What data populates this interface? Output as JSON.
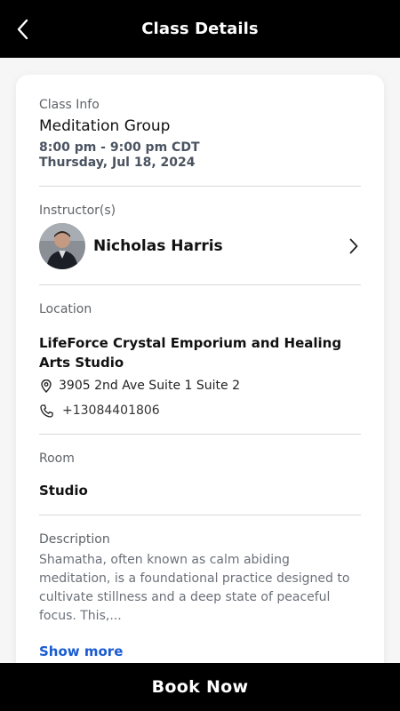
{
  "header": {
    "title": "Class Details",
    "back_icon": "chevron-left-icon"
  },
  "class_info": {
    "label": "Class Info",
    "name": "Meditation Group",
    "time": "8:00 pm - 9:00 pm CDT",
    "date": "Thursday, Jul 18, 2024"
  },
  "instructor": {
    "label": "Instructor(s)",
    "name": "Nicholas Harris",
    "chevron_icon": "chevron-right-icon"
  },
  "location": {
    "label": "Location",
    "name": "LifeForce Crystal Emporium and Healing Arts Studio",
    "address": "3905 2nd Ave Suite 1 Suite 2",
    "phone": "+13084401806",
    "address_icon": "map-pin-icon",
    "phone_icon": "phone-icon"
  },
  "room": {
    "label": "Room",
    "name": "Studio"
  },
  "description": {
    "label": "Description",
    "text": "Shamatha, often known as calm abiding meditation, is a foundational practice designed to cultivate stillness and a deep state of peaceful focus. This,...",
    "show_more": "Show more"
  },
  "footer": {
    "book_label": "Book Now"
  },
  "colors": {
    "header_bg": "#000000",
    "link": "#1a5bd1",
    "label": "#5f6368"
  }
}
